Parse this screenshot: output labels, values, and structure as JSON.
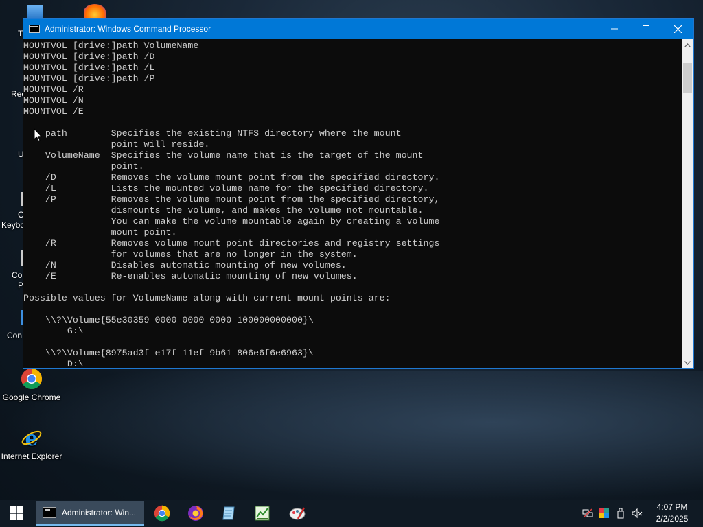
{
  "window": {
    "title": "Administrator: Windows Command Processor",
    "controls": {
      "minimize_icon": "minimize-icon",
      "maximize_icon": "maximize-icon",
      "close_icon": "close-icon"
    }
  },
  "console": {
    "lines": [
      "MOUNTVOL [drive:]path VolumeName",
      "MOUNTVOL [drive:]path /D",
      "MOUNTVOL [drive:]path /L",
      "MOUNTVOL [drive:]path /P",
      "MOUNTVOL /R",
      "MOUNTVOL /N",
      "MOUNTVOL /E",
      "",
      "    path        Specifies the existing NTFS directory where the mount",
      "                point will reside.",
      "    VolumeName  Specifies the volume name that is the target of the mount",
      "                point.",
      "    /D          Removes the volume mount point from the specified directory.",
      "    /L          Lists the mounted volume name for the specified directory.",
      "    /P          Removes the volume mount point from the specified directory,",
      "                dismounts the volume, and makes the volume not mountable.",
      "                You can make the volume mountable again by creating a volume",
      "                mount point.",
      "    /R          Removes volume mount point directories and registry settings",
      "                for volumes that are no longer in the system.",
      "    /N          Disables automatic mounting of new volumes.",
      "    /E          Re-enables automatic mounting of new volumes.",
      "",
      "Possible values for VolumeName along with current mount points are:",
      "",
      "    \\\\?\\Volume{55e30359-0000-0000-0000-100000000000}\\",
      "        G:\\",
      "",
      "    \\\\?\\Volume{8975ad3f-e17f-11ef-9b61-806e6f6e6963}\\",
      "        D:\\"
    ]
  },
  "desktop": {
    "icons": [
      {
        "label": "Google Chrome",
        "icon": "chrome-icon"
      },
      {
        "label": "Internet Explorer",
        "icon": "internet-explorer-icon"
      }
    ],
    "partial_labels": [
      "T",
      "Rec",
      "U",
      "C",
      "Keybo",
      "Co",
      "P",
      "Con"
    ]
  },
  "taskbar": {
    "active_task_label": "Administrator: Win...",
    "pinned": [
      "chrome-icon",
      "firefox-icon",
      "notepad-icon",
      "spreadsheet-icon",
      "paint-icon"
    ],
    "tray_icons": [
      "network-icon",
      "color-icon",
      "usb-icon",
      "volume-muted-icon"
    ],
    "time": "4:07 PM",
    "date": "2/2/2025"
  },
  "colors": {
    "titlebar": "#0078d7",
    "console_bg": "#0c0c0c",
    "console_text": "#cccccc",
    "taskbar": "#101a24"
  }
}
